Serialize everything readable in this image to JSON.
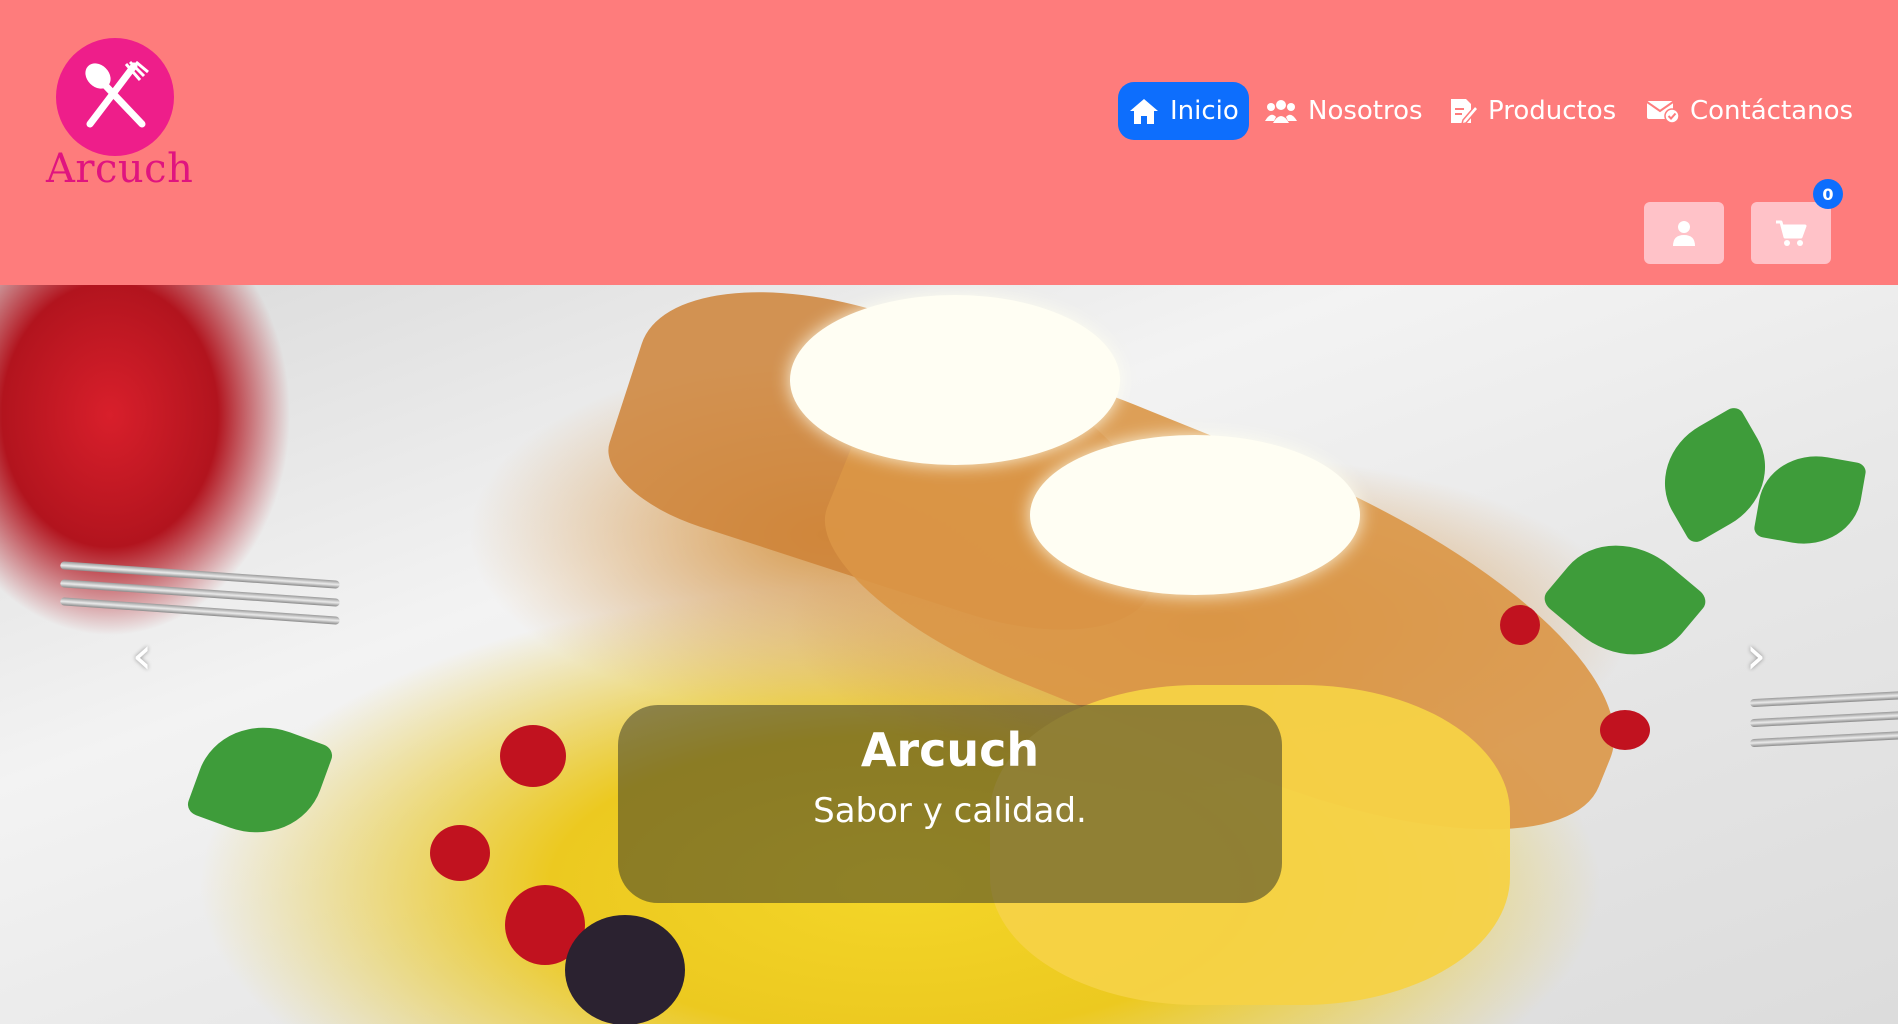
{
  "brand": {
    "name": "Arcuch"
  },
  "nav": {
    "items": [
      {
        "label": "Inicio",
        "icon": "home-icon",
        "active": true
      },
      {
        "label": "Nosotros",
        "icon": "users-icon",
        "active": false
      },
      {
        "label": "Productos",
        "icon": "edit-document-icon",
        "active": false
      },
      {
        "label": "Contáctanos",
        "icon": "envelope-check-icon",
        "active": false
      }
    ]
  },
  "header_actions": {
    "user_icon": "user-icon",
    "cart_icon": "cart-icon",
    "cart_count": "0"
  },
  "carousel": {
    "caption_title": "Arcuch",
    "caption_text": "Sabor y calidad.",
    "prev_label": "‹",
    "next_label": "›"
  },
  "colors": {
    "header_bg": "#fe7c7c",
    "logo_pink": "#ee1e8a",
    "active_nav_bg": "#0d6efd",
    "icon_button_bg": "#ffc2c8",
    "badge_bg": "#0d6efd"
  }
}
